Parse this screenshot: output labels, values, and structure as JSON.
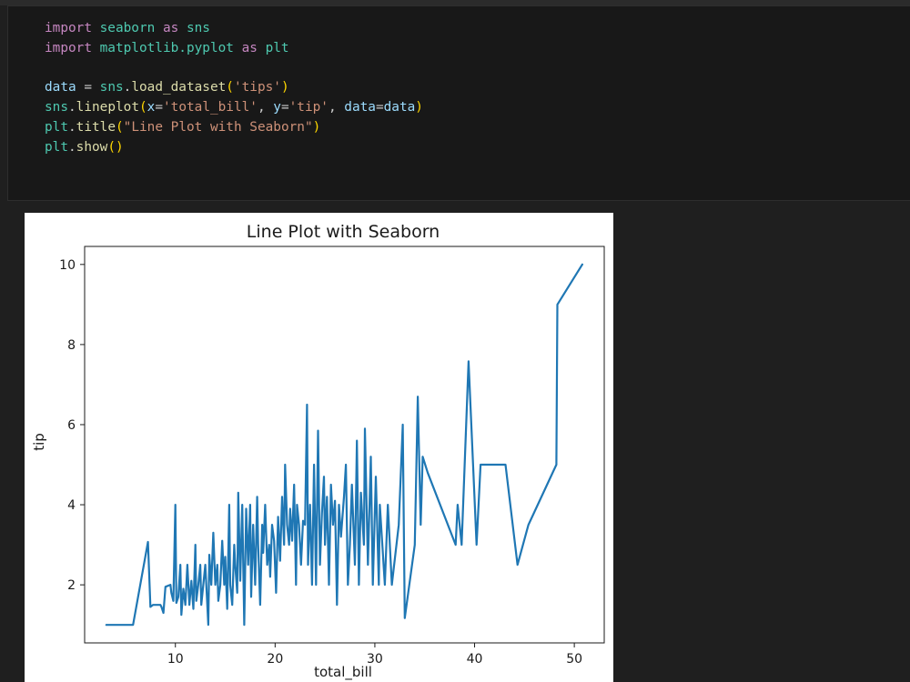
{
  "code_cell": {
    "lines": [
      [
        {
          "t": "import",
          "c": "kw"
        },
        {
          "t": " seaborn ",
          "c": "mod"
        },
        {
          "t": "as",
          "c": "kw"
        },
        {
          "t": " sns",
          "c": "mod"
        }
      ],
      [
        {
          "t": "import",
          "c": "kw"
        },
        {
          "t": " matplotlib.pyplot ",
          "c": "mod"
        },
        {
          "t": "as",
          "c": "kw"
        },
        {
          "t": " plt",
          "c": "mod"
        }
      ],
      [],
      [
        {
          "t": "data",
          "c": "var"
        },
        {
          "t": " = ",
          "c": "pun"
        },
        {
          "t": "sns",
          "c": "mod"
        },
        {
          "t": ".",
          "c": "pun"
        },
        {
          "t": "load_dataset",
          "c": "fn"
        },
        {
          "t": "(",
          "c": "paren"
        },
        {
          "t": "'tips'",
          "c": "str"
        },
        {
          "t": ")",
          "c": "paren"
        }
      ],
      [
        {
          "t": "sns",
          "c": "mod"
        },
        {
          "t": ".",
          "c": "pun"
        },
        {
          "t": "lineplot",
          "c": "fn"
        },
        {
          "t": "(",
          "c": "paren"
        },
        {
          "t": "x",
          "c": "var"
        },
        {
          "t": "=",
          "c": "pun"
        },
        {
          "t": "'total_bill'",
          "c": "str"
        },
        {
          "t": ", ",
          "c": "pun"
        },
        {
          "t": "y",
          "c": "var"
        },
        {
          "t": "=",
          "c": "pun"
        },
        {
          "t": "'tip'",
          "c": "str"
        },
        {
          "t": ", ",
          "c": "pun"
        },
        {
          "t": "data",
          "c": "var"
        },
        {
          "t": "=",
          "c": "pun"
        },
        {
          "t": "data",
          "c": "var"
        },
        {
          "t": ")",
          "c": "paren"
        }
      ],
      [
        {
          "t": "plt",
          "c": "mod"
        },
        {
          "t": ".",
          "c": "pun"
        },
        {
          "t": "title",
          "c": "fn"
        },
        {
          "t": "(",
          "c": "paren"
        },
        {
          "t": "\"Line Plot with Seaborn\"",
          "c": "str"
        },
        {
          "t": ")",
          "c": "paren"
        }
      ],
      [
        {
          "t": "plt",
          "c": "mod"
        },
        {
          "t": ".",
          "c": "pun"
        },
        {
          "t": "show",
          "c": "fn"
        },
        {
          "t": "()",
          "c": "paren"
        }
      ]
    ]
  },
  "chart_data": {
    "type": "line",
    "title": "Line Plot with Seaborn",
    "xlabel": "total_bill",
    "ylabel": "tip",
    "xlim": [
      0.9,
      53.0
    ],
    "ylim": [
      0.55,
      10.45
    ],
    "xticks": [
      10,
      20,
      30,
      40,
      50
    ],
    "yticks": [
      2,
      4,
      6,
      8,
      10
    ],
    "grid": false,
    "line_color": "#1f77b4",
    "band_color": "#c9d9ea",
    "series": [
      {
        "x": [
          3.07,
          5.75,
          7.25,
          7.5,
          7.75,
          8.5,
          8.6,
          8.8,
          9.0,
          9.5,
          9.6,
          9.8,
          10.0,
          10.1,
          10.3,
          10.5,
          10.6,
          10.8,
          11.0,
          11.2,
          11.4,
          11.6,
          11.8,
          12.0,
          12.1,
          12.3,
          12.5,
          12.6,
          12.8,
          13.0,
          13.1,
          13.3,
          13.4,
          13.6,
          13.8,
          14.0,
          14.2,
          14.3,
          14.5,
          14.7,
          14.9,
          15.0,
          15.2,
          15.4,
          15.5,
          15.7,
          15.9,
          16.0,
          16.2,
          16.3,
          16.5,
          16.7,
          16.9,
          17.1,
          17.3,
          17.5,
          17.6,
          17.8,
          18.0,
          18.2,
          18.3,
          18.5,
          18.7,
          18.8,
          19.0,
          19.2,
          19.4,
          19.5,
          19.7,
          19.9,
          20.1,
          20.3,
          20.5,
          20.7,
          20.9,
          21.0,
          21.2,
          21.4,
          21.5,
          21.7,
          21.9,
          22.1,
          22.2,
          22.4,
          22.6,
          22.8,
          23.0,
          23.2,
          23.3,
          23.5,
          23.7,
          23.9,
          24.1,
          24.3,
          24.5,
          24.7,
          24.9,
          25.0,
          25.2,
          25.4,
          25.6,
          25.8,
          26.0,
          26.2,
          26.4,
          26.6,
          26.9,
          27.1,
          27.3,
          27.5,
          27.7,
          28.0,
          28.2,
          28.4,
          28.6,
          28.9,
          29.0,
          29.3,
          29.6,
          29.8,
          30.1,
          30.4,
          30.5,
          31.0,
          31.3,
          31.7,
          32.4,
          32.8,
          33.0,
          34.0,
          34.3,
          34.6,
          34.8,
          35.3,
          38.1,
          38.3,
          38.7,
          39.4,
          40.2,
          40.6,
          41.2,
          43.1,
          44.3,
          45.4,
          48.2,
          48.3,
          50.8
        ],
        "y": [
          1.0,
          1.0,
          3.07,
          1.45,
          1.5,
          1.5,
          1.45,
          1.3,
          1.95,
          2.0,
          1.8,
          1.6,
          4.0,
          1.55,
          1.7,
          2.5,
          1.25,
          1.9,
          1.5,
          2.5,
          1.5,
          2.1,
          1.4,
          3.0,
          1.6,
          2.0,
          2.5,
          1.5,
          2.0,
          2.5,
          2.0,
          1.0,
          2.75,
          2.0,
          3.3,
          2.0,
          2.5,
          1.6,
          2.0,
          3.1,
          2.0,
          2.7,
          1.4,
          4.0,
          2.0,
          1.5,
          3.0,
          2.5,
          1.8,
          4.3,
          2.1,
          4.0,
          1.0,
          3.9,
          2.5,
          4.0,
          1.7,
          3.5,
          2.0,
          4.2,
          3.0,
          1.5,
          3.5,
          2.8,
          4.0,
          2.5,
          3.0,
          2.2,
          3.5,
          3.1,
          1.8,
          3.7,
          2.6,
          4.2,
          3.0,
          5.0,
          3.5,
          3.0,
          3.9,
          3.1,
          4.5,
          2.0,
          4.0,
          3.5,
          2.5,
          3.6,
          3.5,
          6.5,
          2.5,
          4.0,
          2.0,
          5.0,
          2.0,
          5.85,
          2.5,
          3.8,
          4.7,
          3.0,
          4.2,
          2.0,
          4.5,
          3.5,
          4.1,
          1.5,
          4.0,
          3.2,
          4.2,
          5.0,
          2.0,
          3.0,
          4.5,
          2.5,
          5.6,
          2.0,
          4.3,
          3.0,
          5.9,
          2.5,
          5.2,
          2.0,
          4.7,
          2.0,
          4.0,
          2.0,
          4.0,
          2.0,
          3.5,
          6.0,
          1.17,
          3.0,
          6.7,
          3.5,
          5.2,
          4.8,
          3.0,
          4.0,
          3.0,
          7.58,
          3.0,
          5.0,
          5.0,
          5.0,
          2.5,
          3.5,
          5.0,
          9.0,
          10.0
        ]
      }
    ]
  }
}
